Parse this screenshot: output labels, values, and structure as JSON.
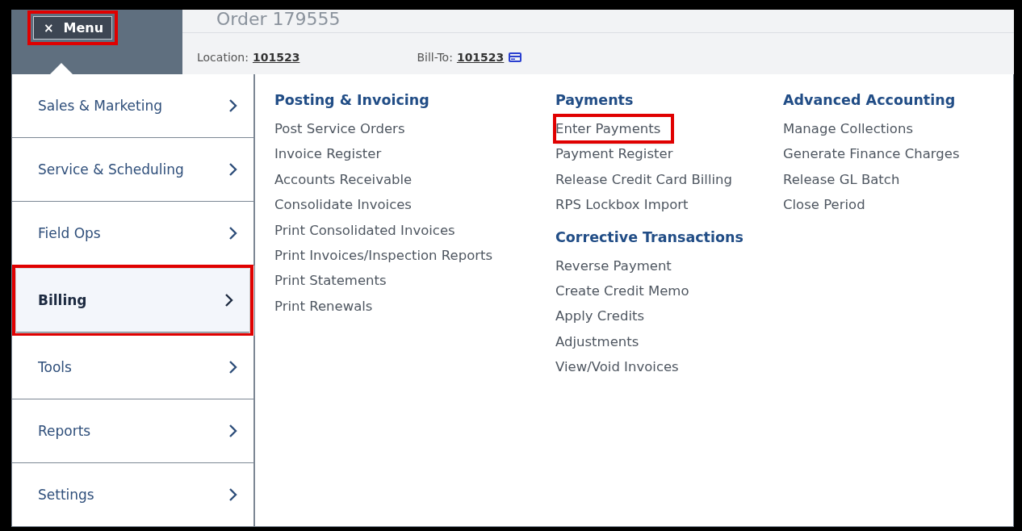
{
  "menu_button": {
    "icon": "×",
    "label": "Menu",
    "highlighted": true
  },
  "header": {
    "title": "Order 179555",
    "location_label": "Location:",
    "location": "101523",
    "bill_to_label": "Bill-To:",
    "bill_to": "101523"
  },
  "nav": [
    {
      "label": "Sales & Marketing",
      "selected": false,
      "highlighted": false
    },
    {
      "label": "Service & Scheduling",
      "selected": false,
      "highlighted": false
    },
    {
      "label": "Field Ops",
      "selected": false,
      "highlighted": false
    },
    {
      "label": "Billing",
      "selected": true,
      "highlighted": true
    },
    {
      "label": "Tools",
      "selected": false,
      "highlighted": false
    },
    {
      "label": "Reports",
      "selected": false,
      "highlighted": false
    },
    {
      "label": "Settings",
      "selected": false,
      "highlighted": false
    }
  ],
  "columns": [
    {
      "sections": [
        {
          "heading": "Posting & Invoicing",
          "links": [
            {
              "label": "Post Service Orders",
              "highlighted": false
            },
            {
              "label": "Invoice Register",
              "highlighted": false
            },
            {
              "label": "Accounts Receivable",
              "highlighted": false
            },
            {
              "label": "Consolidate Invoices",
              "highlighted": false
            },
            {
              "label": "Print Consolidated Invoices",
              "highlighted": false
            },
            {
              "label": "Print Invoices/Inspection Reports",
              "highlighted": false
            },
            {
              "label": "Print Statements",
              "highlighted": false
            },
            {
              "label": "Print Renewals",
              "highlighted": false
            }
          ]
        }
      ]
    },
    {
      "sections": [
        {
          "heading": "Payments",
          "links": [
            {
              "label": "Enter Payments",
              "highlighted": true
            },
            {
              "label": "Payment Register",
              "highlighted": false
            },
            {
              "label": "Release Credit Card Billing",
              "highlighted": false
            },
            {
              "label": "RPS Lockbox Import",
              "highlighted": false
            }
          ]
        },
        {
          "heading": "Corrective Transactions",
          "links": [
            {
              "label": "Reverse Payment",
              "highlighted": false
            },
            {
              "label": "Create Credit Memo",
              "highlighted": false
            },
            {
              "label": "Apply Credits",
              "highlighted": false
            },
            {
              "label": "Adjustments",
              "highlighted": false
            },
            {
              "label": "View/Void Invoices",
              "highlighted": false
            }
          ]
        }
      ]
    },
    {
      "sections": [
        {
          "heading": "Advanced Accounting",
          "links": [
            {
              "label": "Manage Collections",
              "highlighted": false
            },
            {
              "label": "Generate Finance Charges",
              "highlighted": false
            },
            {
              "label": "Release GL Batch",
              "highlighted": false
            },
            {
              "label": "Close Period",
              "highlighted": false
            }
          ]
        }
      ]
    }
  ]
}
